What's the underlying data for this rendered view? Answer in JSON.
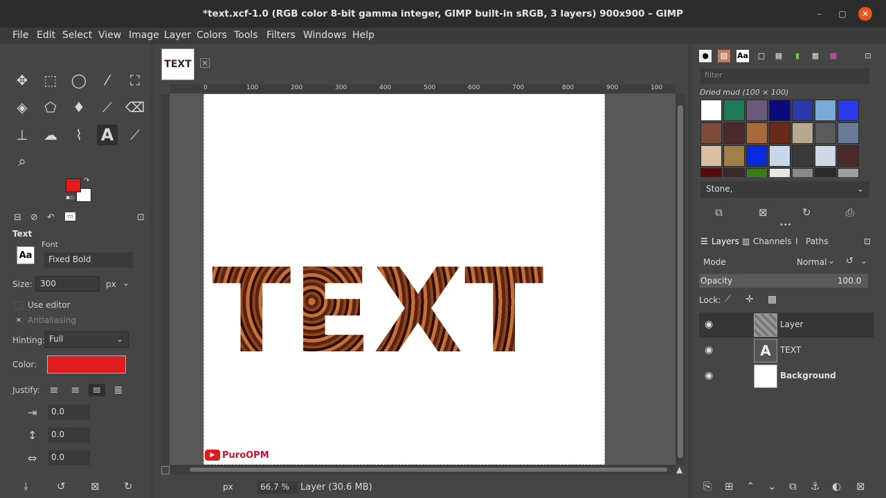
{
  "window": {
    "title": "*text.xcf-1.0 (RGB color 8-bit gamma integer, GIMP built-in sRGB, 3 layers) 900x900 – GIMP",
    "minimize": "–",
    "maximize": "▢",
    "close": "✕"
  },
  "menu": [
    "File",
    "Edit",
    "Select",
    "View",
    "Image",
    "Layer",
    "Colors",
    "Tools",
    "Filters",
    "Windows",
    "Help"
  ],
  "toolbox": {
    "tools": [
      {
        "icon": "move-icon",
        "glyph": "✥"
      },
      {
        "icon": "rect-select-icon",
        "glyph": "⬚"
      },
      {
        "icon": "lasso-icon",
        "glyph": "◯"
      },
      {
        "icon": "fuzzy-select-icon",
        "glyph": "⁄"
      },
      {
        "icon": "crop-icon",
        "glyph": "⛶"
      },
      {
        "icon": "warp-icon",
        "glyph": "◈"
      },
      {
        "icon": "transform-icon",
        "glyph": "⬠"
      },
      {
        "icon": "bucket-icon",
        "glyph": "♦"
      },
      {
        "icon": "paintbrush-icon",
        "glyph": "⟋"
      },
      {
        "icon": "eraser-icon",
        "glyph": "⌫"
      },
      {
        "icon": "clone-icon",
        "glyph": "⊥"
      },
      {
        "icon": "smudge-icon",
        "glyph": "☁"
      },
      {
        "icon": "paths-icon",
        "glyph": "⌇"
      },
      {
        "icon": "text-tool-icon",
        "glyph": "A"
      },
      {
        "icon": "color-picker-icon",
        "glyph": "⟋"
      },
      {
        "icon": "zoom-icon",
        "glyph": "⌕"
      }
    ],
    "fg_color": "#e01c1c",
    "bg_color": "#ffffff"
  },
  "tool_options": {
    "title": "Text",
    "font_label": "Font",
    "font_preview": "Aa",
    "font_name": "Fixed Bold",
    "size_label": "Size:",
    "size_value": "300",
    "size_unit": "px",
    "use_editor": "Use editor",
    "antialiasing": "Antialiasing",
    "hinting_label": "Hinting:",
    "hinting_value": "Full",
    "color_label": "Color:",
    "text_color": "#e01c1c",
    "justify_label": "Justify:",
    "indent": "0.0",
    "line_spacing": "0.0",
    "letter_spacing": "0.0"
  },
  "canvas": {
    "tab_label": "TEXT",
    "text": "TEXT",
    "ruler_labels": [
      "0",
      "100",
      "200",
      "300",
      "400",
      "500",
      "600",
      "700",
      "800",
      "900",
      "100"
    ],
    "watermark": "PuroOPM",
    "watermark_icon": "▶"
  },
  "statusbar": {
    "unit": "px",
    "zoom": "66.7 %",
    "info": "Layer (30.6 MB)"
  },
  "patterns": {
    "filter_placeholder": "filter",
    "current": "Dried mud (100 × 100)",
    "tag_select": "Stone,",
    "swatches": [
      "#ffffff",
      "#1f7a5a",
      "#6a5a7a",
      "#0a0a7a",
      "#2a3aaa",
      "#7aaad8",
      "#2a3ae8",
      "#7a4a3a",
      "#4a2a2a",
      "#a86a3a",
      "#6a2a1a",
      "#b8a890",
      "#5a5a5a",
      "#6a7a9a",
      "#d8c0a0",
      "#a0804a",
      "#0a2ae0",
      "#c8d8e8",
      "#3a3a3a",
      "#d0d8e8",
      "#4a2a2a",
      "#5a0a0a",
      "#3a2a2a",
      "#3a7a1a",
      "#e8e8e8",
      "#888888",
      "#2a2a2a",
      "#a0a0a0"
    ]
  },
  "layers_panel": {
    "tabs": [
      "Layers",
      "Channels",
      "Paths"
    ],
    "mode_label": "Mode",
    "mode_value": "Normal",
    "opacity_label": "Opacity",
    "opacity_value": "100.0",
    "lock_label": "Lock:",
    "layers": [
      {
        "name": "Layer",
        "visible": true,
        "selected": true
      },
      {
        "name": "TEXT",
        "visible": true,
        "selected": false
      },
      {
        "name": "Background",
        "visible": true,
        "selected": false
      }
    ]
  }
}
